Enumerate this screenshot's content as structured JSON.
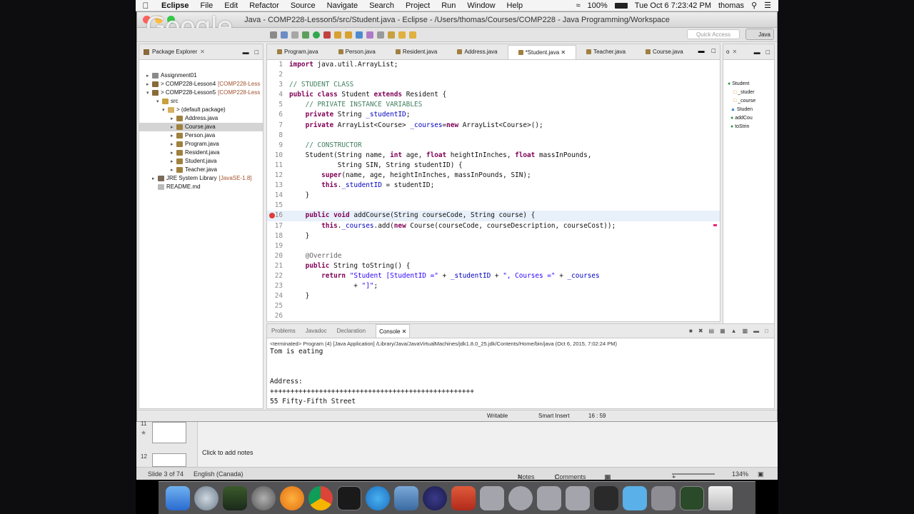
{
  "menubar": {
    "app": "Eclipse",
    "items": [
      "File",
      "Edit",
      "Refactor",
      "Source",
      "Navigate",
      "Search",
      "Project",
      "Run",
      "Window",
      "Help"
    ],
    "battery": "100%",
    "clock": "Tue Oct 6  7:23:42 PM",
    "user": "thomas"
  },
  "window": {
    "title": "Java - COMP228-Lesson5/src/Student.java - Eclipse - /Users/thomas/Courses/COMP228 - Java Programming/Workspace",
    "google_overlay": "Google",
    "quick_access": "Quick Access",
    "perspective": "Java"
  },
  "package_explorer": {
    "title": "Package Explorer",
    "rows": [
      {
        "label": "Assignment01",
        "extra": ""
      },
      {
        "label": "> COMP228-Lesson4",
        "extra": "[COMP228-Less"
      },
      {
        "label": "> COMP228-Lesson5",
        "extra": "[COMP228-Less"
      },
      {
        "label": "src",
        "extra": ""
      },
      {
        "label": "> (default package)",
        "extra": ""
      },
      {
        "label": "Address.java",
        "extra": ""
      },
      {
        "label": "Course.java",
        "extra": ""
      },
      {
        "label": "Person.java",
        "extra": ""
      },
      {
        "label": "Program.java",
        "extra": ""
      },
      {
        "label": "Resident.java",
        "extra": ""
      },
      {
        "label": "Student.java",
        "extra": ""
      },
      {
        "label": "Teacher.java",
        "extra": ""
      },
      {
        "label": "JRE System Library",
        "extra": "[JavaSE-1.8]"
      },
      {
        "label": "README.md",
        "extra": ""
      }
    ]
  },
  "editor": {
    "tabs": [
      "Program.java",
      "Person.java",
      "Resident.java",
      "Address.java",
      "*Student.java",
      "Teacher.java",
      "Course.java"
    ],
    "line_numbers": [
      "1",
      "2",
      "3",
      "4",
      "5",
      "6",
      "7",
      "8",
      "9",
      "10",
      "11",
      "12",
      "13",
      "14",
      "15",
      "16",
      "17",
      "18",
      "19",
      "20",
      "21",
      "22",
      "23",
      "24",
      "25",
      "26"
    ]
  },
  "outline": {
    "items": [
      "Student",
      "_studer",
      "_course",
      "Studen",
      "addCou",
      "toStrin"
    ]
  },
  "console": {
    "tabs": [
      "Problems",
      "Javadoc",
      "Declaration",
      "Console"
    ],
    "info": "<terminated> Program (4) [Java Application] /Library/Java/JavaVirtualMachines/jdk1.8.0_25.jdk/Contents/Home/bin/java (Oct 6, 2015, 7:02:24 PM)",
    "lines": [
      "Tom is eating",
      "",
      "",
      "Address:",
      "++++++++++++++++++++++++++++++++++++++++++++++++++",
      "55 Fifty-Fifth Street"
    ]
  },
  "status": {
    "writable": "Writable",
    "insert": "Smart Insert",
    "position": "16 : 59"
  },
  "powerpoint": {
    "slide_11": "11",
    "slide_12": "12",
    "notes_placeholder": "Click to add notes",
    "slide_info": "Slide 3 of 74",
    "language": "English (Canada)",
    "notes_btn": "Notes",
    "comments_btn": "Comments",
    "zoom": "134%"
  },
  "colors": {
    "keyword": "#7f0055",
    "comment": "#3f7f5f",
    "string": "#2a00ff",
    "field": "#0000c0"
  }
}
